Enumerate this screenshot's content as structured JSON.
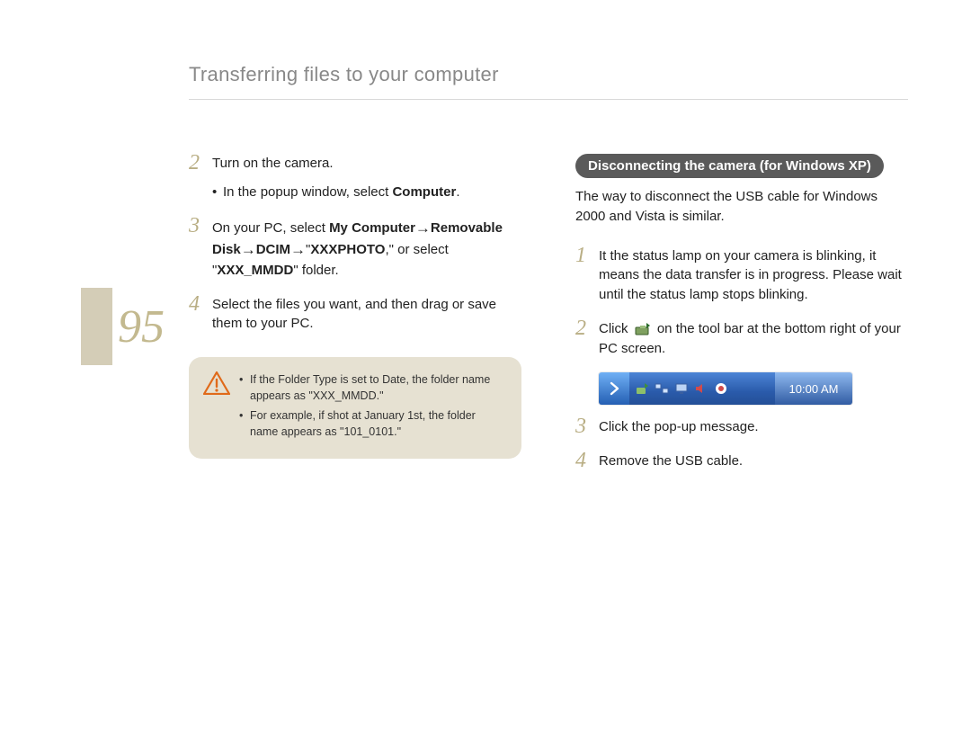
{
  "pageNumber": "95",
  "header": {
    "title": "Transferring files to your computer"
  },
  "left": {
    "step2": {
      "num": "2",
      "text": "Turn on the camera.",
      "bullet1_pre": "In the popup window, select ",
      "bullet1_bold": "Computer",
      "bullet1_post": "."
    },
    "step3": {
      "num": "3",
      "pre": "On your PC, select ",
      "b1": "My Computer",
      "arrow1": " → ",
      "b2": "Removable Disk",
      "arrow2": " → ",
      "b3": "DCIM",
      "arrow3": " → ",
      "b4_open": "\"",
      "b4": "XXXPHOTO",
      "mid": ",\" or select \"",
      "b5": "XXX_MMDD",
      "post": "\" folder."
    },
    "step4": {
      "num": "4",
      "text": "Select the files you want, and then drag or save them to your PC."
    },
    "note": {
      "item1": "If the Folder Type is set to Date, the folder name appears as \"XXX_MMDD.\"",
      "item2": "For example, if shot at January 1st, the folder name appears as \"101_0101.\""
    }
  },
  "right": {
    "subheading": "Disconnecting the camera (for Windows XP)",
    "intro": "The way to disconnect the USB cable for Windows 2000 and Vista is similar.",
    "step1": {
      "num": "1",
      "text": "It the status lamp on your camera is blinking, it means the data transfer is in progress. Please wait until the status lamp stops blinking."
    },
    "step2": {
      "num": "2",
      "pre": "Click ",
      "post": " on the tool bar at the bottom right of your PC screen."
    },
    "taskbar": {
      "clock": "10:00 AM"
    },
    "step3": {
      "num": "3",
      "text": "Click the pop-up message."
    },
    "step4": {
      "num": "4",
      "text": "Remove the USB cable."
    }
  }
}
